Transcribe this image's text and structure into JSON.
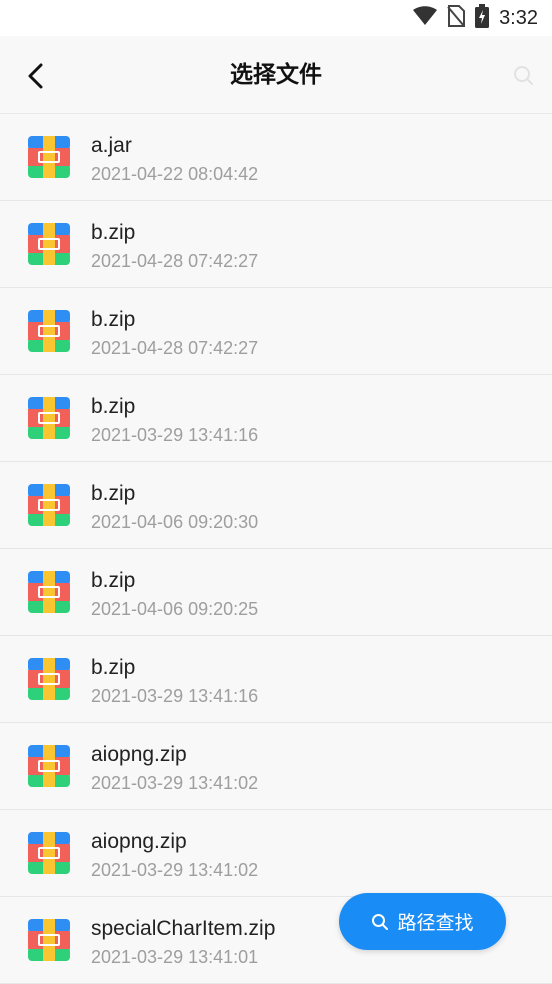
{
  "status_bar": {
    "time": "3:32",
    "icons": [
      "wifi-icon",
      "no-sim-icon",
      "battery-charging-icon"
    ]
  },
  "header": {
    "title": "选择文件",
    "back_icon": "chevron-left-icon",
    "search_icon": "search-icon"
  },
  "files": [
    {
      "name": "a.jar",
      "time": "2021-04-22 08:04:42"
    },
    {
      "name": "b.zip",
      "time": "2021-04-28 07:42:27"
    },
    {
      "name": "b.zip",
      "time": "2021-04-28 07:42:27"
    },
    {
      "name": "b.zip",
      "time": "2021-03-29 13:41:16"
    },
    {
      "name": "b.zip",
      "time": "2021-04-06 09:20:30"
    },
    {
      "name": "b.zip",
      "time": "2021-04-06 09:20:25"
    },
    {
      "name": "b.zip",
      "time": "2021-03-29 13:41:16"
    },
    {
      "name": "aiopng.zip",
      "time": "2021-03-29 13:41:02"
    },
    {
      "name": "aiopng.zip",
      "time": "2021-03-29 13:41:02"
    },
    {
      "name": "specialCharItem.zip",
      "time": "2021-03-29 13:41:01"
    }
  ],
  "fab": {
    "label": "路径查找",
    "icon": "search-icon"
  },
  "colors": {
    "accent": "#1a8cf6",
    "icon_blue": "#2f8ef4",
    "icon_red": "#f2605a",
    "icon_green": "#2fd07a",
    "icon_yellow": "#f9c531"
  }
}
